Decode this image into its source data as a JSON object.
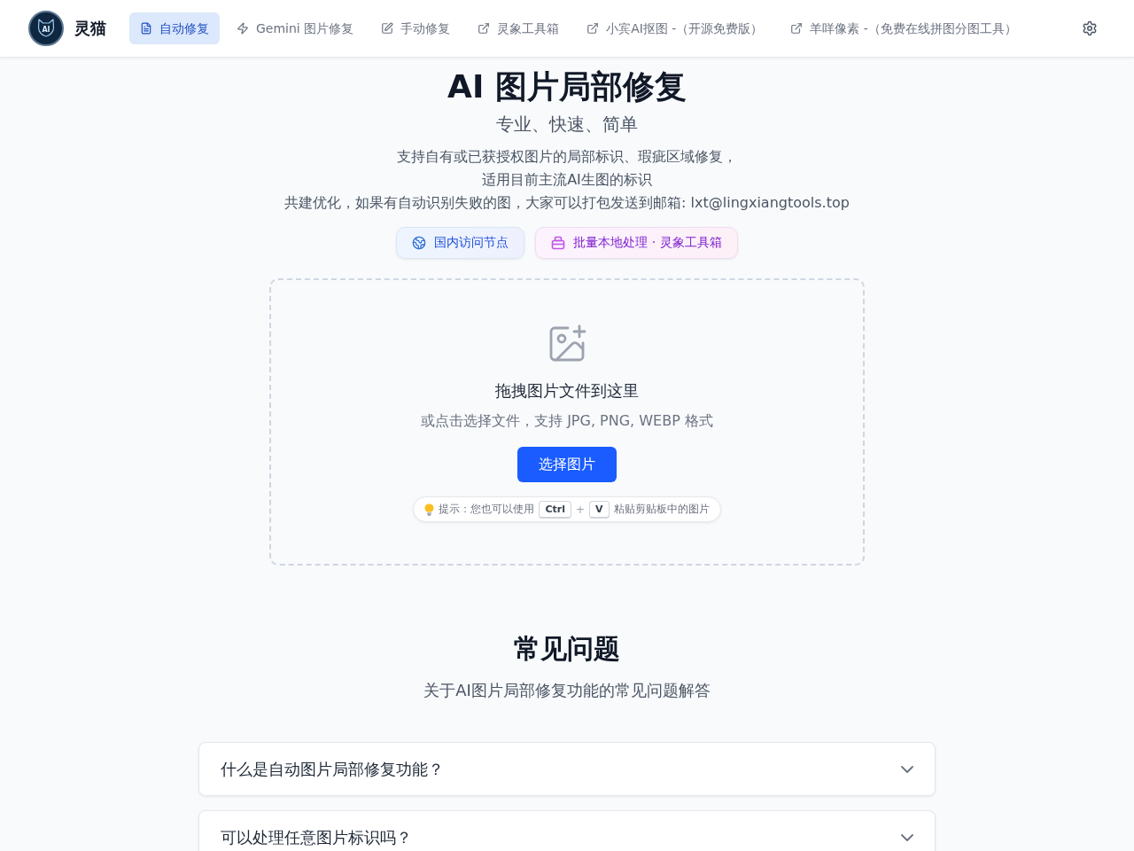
{
  "header": {
    "logo_text": "AI",
    "brand": "灵猫",
    "nav": [
      {
        "label": "自动修复",
        "selected": true,
        "kind": "internal"
      },
      {
        "label": "Gemini 图片修复",
        "selected": false,
        "kind": "internal"
      },
      {
        "label": "手动修复",
        "selected": false,
        "kind": "internal"
      },
      {
        "label": "灵象工具箱",
        "selected": false,
        "kind": "external"
      },
      {
        "label": "小宾AI抠图 -（开源免费版）",
        "selected": false,
        "kind": "external"
      },
      {
        "label": "羊咩像素 -（免费在线拼图分图工具）",
        "selected": false,
        "kind": "external"
      }
    ]
  },
  "hero": {
    "title": "AI 图片局部修复",
    "subtitle": "专业、快速、简单",
    "description": [
      "支持自有或已获授权图片的局部标识、瑕疵区域修复，",
      "适用目前主流AI生图的标识",
      "共建优化，如果有自动识别失败的图，大家可以打包发送到邮箱: lxt@lingxiangtools.top"
    ],
    "links": [
      {
        "label": "国内访问节点",
        "kind": "mirror"
      },
      {
        "label": "批量本地处理 · 灵象工具箱",
        "kind": "toolbox"
      }
    ]
  },
  "upload": {
    "title": "拖拽图片文件到这里",
    "hint": "或点击选择文件，支持 JPG, PNG, WEBP 格式",
    "button": "选择图片",
    "tip": {
      "text_before": "提示：您也可以使用",
      "keys": [
        "Ctrl",
        "V"
      ],
      "joiner": "+",
      "text_after": "粘贴剪贴板中的图片"
    }
  },
  "faq": {
    "title": "常见问题",
    "subtitle": "关于AI图片局部修复功能的常见问题解答",
    "items": [
      {
        "question": "什么是自动图片局部修复功能？",
        "expanded": false
      },
      {
        "question": "可以处理任意图片标识吗？",
        "expanded": false
      }
    ]
  }
}
